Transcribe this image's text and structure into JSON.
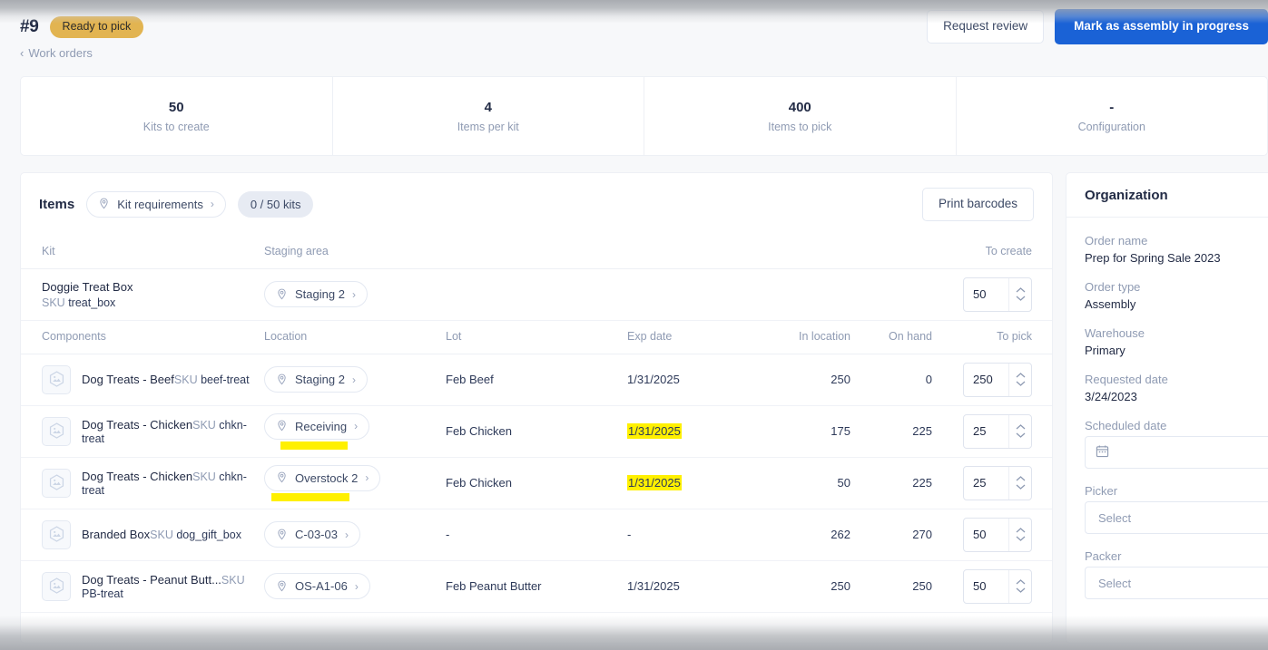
{
  "header": {
    "order_number": "#9",
    "status": "Ready to pick",
    "breadcrumb": "Work orders",
    "breadcrumb_icon": "chevron-left-icon",
    "actions": {
      "request_review": "Request review",
      "mark_in_progress": "Mark as assembly in progress"
    },
    "accent_blue": "#1a62d6",
    "status_color": "#e2b451"
  },
  "stats": [
    {
      "value": "50",
      "label": "Kits to create"
    },
    {
      "value": "4",
      "label": "Items per kit"
    },
    {
      "value": "400",
      "label": "Items to pick"
    },
    {
      "value": "-",
      "label": "Configuration"
    }
  ],
  "items": {
    "title": "Items",
    "kit_requirements": "Kit requirements",
    "kits_progress": "0 / 50 kits",
    "print_barcodes": "Print barcodes",
    "kit_columns": [
      "Kit",
      "Staging area",
      "To create"
    ],
    "kit_row": {
      "name": "Doggie Treat Box",
      "sku_label": "SKU",
      "sku": "treat_box",
      "staging_area": "Staging 2",
      "to_create": "50"
    },
    "component_columns": [
      "Components",
      "Location",
      "Lot",
      "Exp date",
      "In location",
      "On hand",
      "To pick"
    ],
    "component_rows": [
      {
        "name": "Dog Treats - Beef",
        "sku_label": "SKU",
        "sku": "beef-treat",
        "location": "Staging 2",
        "location_highlighted": false,
        "lot": "Feb Beef",
        "exp_date": "1/31/2025",
        "exp_highlighted": false,
        "in_location": "250",
        "on_hand": "0",
        "to_pick": "250"
      },
      {
        "name": "Dog Treats - Chicken",
        "sku_label": "SKU",
        "sku": "chkn-treat",
        "location": "Receiving",
        "location_highlighted": true,
        "lot": "Feb Chicken",
        "exp_date": "1/31/2025",
        "exp_highlighted": true,
        "in_location": "175",
        "on_hand": "225",
        "to_pick": "25"
      },
      {
        "name": "Dog Treats - Chicken",
        "sku_label": "SKU",
        "sku": "chkn-treat",
        "location": "Overstock 2",
        "location_highlighted": true,
        "lot": "Feb Chicken",
        "exp_date": "1/31/2025",
        "exp_highlighted": true,
        "in_location": "50",
        "on_hand": "225",
        "to_pick": "25"
      },
      {
        "name": "Branded Box",
        "sku_label": "SKU",
        "sku": "dog_gift_box",
        "location": "C-03-03",
        "location_highlighted": false,
        "lot": "-",
        "exp_date": "-",
        "exp_highlighted": false,
        "in_location": "262",
        "on_hand": "270",
        "to_pick": "50"
      },
      {
        "name": "Dog Treats - Peanut Butt...",
        "sku_label": "SKU",
        "sku": "PB-treat",
        "location": "OS-A1-06",
        "location_highlighted": false,
        "lot": "Feb Peanut Butter",
        "exp_date": "1/31/2025",
        "exp_highlighted": false,
        "in_location": "250",
        "on_hand": "250",
        "to_pick": "50"
      }
    ]
  },
  "sidebar": {
    "title": "Organization",
    "fields": [
      {
        "label": "Order name",
        "value": "Prep for Spring Sale 2023"
      },
      {
        "label": "Order type",
        "value": "Assembly"
      },
      {
        "label": "Warehouse",
        "value": "Primary"
      },
      {
        "label": "Requested date",
        "value": "3/24/2023"
      }
    ],
    "scheduled_date": {
      "label": "Scheduled date",
      "value": "",
      "icon": "calendar-icon"
    },
    "picker": {
      "label": "Picker",
      "placeholder": "Select"
    },
    "packer": {
      "label": "Packer",
      "placeholder": "Select"
    }
  }
}
